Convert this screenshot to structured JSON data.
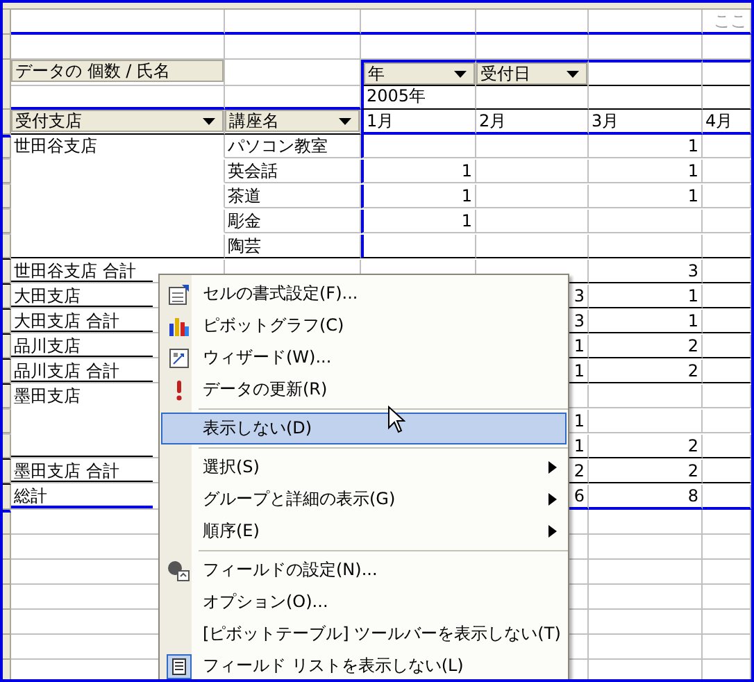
{
  "sheet": {
    "drop_zone_hint": "ここ",
    "pivot": {
      "data_field": "データの 個数 / 氏名",
      "column_fields": [
        {
          "label": "年"
        },
        {
          "label": "受付日"
        }
      ],
      "year": "2005年",
      "row_fields": [
        {
          "label": "受付支店"
        },
        {
          "label": "講座名"
        }
      ],
      "months": [
        "1月",
        "2月",
        "3月",
        "4月"
      ],
      "rows": [
        {
          "kind": "item",
          "branch": "世田谷支店",
          "course": "パソコン教室",
          "month_3": "1"
        },
        {
          "kind": "item",
          "course": "英会話",
          "month_1": "1",
          "month_3": "1"
        },
        {
          "kind": "item",
          "course": "茶道",
          "month_1": "1",
          "month_3": "1"
        },
        {
          "kind": "item",
          "course": "彫金",
          "month_1": "1"
        },
        {
          "kind": "item",
          "course": "陶芸"
        },
        {
          "kind": "subtotal",
          "branch": "世田谷支店 合計",
          "month_3": "3"
        },
        {
          "kind": "item",
          "branch": "大田支店",
          "month_2": "3",
          "month_3": "1"
        },
        {
          "kind": "subtotal",
          "branch": "大田支店 合計",
          "month_2": "3",
          "month_3": "1"
        },
        {
          "kind": "item",
          "branch": "品川支店",
          "month_2": "1",
          "month_3": "2"
        },
        {
          "kind": "subtotal",
          "branch": "品川支店 合計",
          "month_2": "1",
          "month_3": "2"
        },
        {
          "kind": "item",
          "branch": "墨田支店"
        },
        {
          "kind": "item",
          "month_2": "1"
        },
        {
          "kind": "item",
          "month_2": "1",
          "month_3": "2"
        },
        {
          "kind": "subtotal",
          "branch": "墨田支店 合計",
          "month_2": "2",
          "month_3": "2"
        },
        {
          "kind": "total",
          "branch": "総計",
          "month_2": "6",
          "month_3": "8"
        }
      ]
    }
  },
  "context_menu": {
    "items": [
      {
        "kind": "item",
        "label": "セルの書式設定(F)...",
        "submenu": false,
        "selected": false
      },
      {
        "kind": "item",
        "label": "ピボットグラフ(C)",
        "submenu": false,
        "selected": false
      },
      {
        "kind": "item",
        "label": "ウィザード(W)...",
        "submenu": false,
        "selected": false
      },
      {
        "kind": "item",
        "label": "データの更新(R)",
        "submenu": false,
        "selected": false
      },
      {
        "kind": "separator"
      },
      {
        "kind": "item",
        "label": "表示しない(D)",
        "submenu": false,
        "selected": true
      },
      {
        "kind": "separator"
      },
      {
        "kind": "item",
        "label": "選択(S)",
        "submenu": true,
        "selected": false
      },
      {
        "kind": "item",
        "label": "グループと詳細の表示(G)",
        "submenu": true,
        "selected": false
      },
      {
        "kind": "item",
        "label": "順序(E)",
        "submenu": true,
        "selected": false
      },
      {
        "kind": "separator"
      },
      {
        "kind": "item",
        "label": "フィールドの設定(N)...",
        "submenu": false,
        "selected": false
      },
      {
        "kind": "item",
        "label": "オプション(O)...",
        "submenu": false,
        "selected": false
      },
      {
        "kind": "item",
        "label": "[ピボットテーブル] ツールバーを表示しない(T)",
        "submenu": false,
        "selected": false
      },
      {
        "kind": "item",
        "label": "フィールド リストを表示しない(L)",
        "submenu": false,
        "selected": false
      }
    ]
  }
}
